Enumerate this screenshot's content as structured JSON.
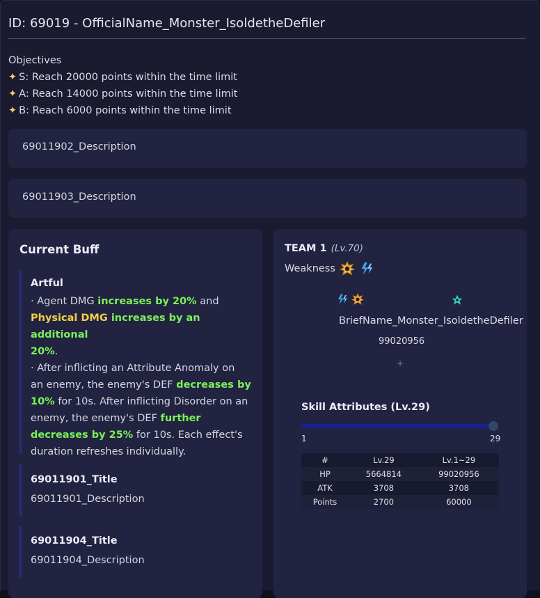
{
  "header": {
    "title": "ID: 69019 - OfficialName_Monster_IsoldetheDefiler"
  },
  "objectives": {
    "heading": "Objectives",
    "items": [
      "S: Reach 20000 points within the time limit",
      "A: Reach 14000 points within the time limit",
      "B: Reach 6000 points within the time limit"
    ]
  },
  "descriptions": [
    "69011902_Description",
    "69011903_Description"
  ],
  "buff": {
    "heading": "Current Buff",
    "artful": {
      "title": "Artful",
      "l1_a": "· Agent DMG ",
      "l1_b": "increases by 20%",
      "l1_c": " and",
      "l2_a": "Physical DMG",
      "l2_b": " increases by an additional",
      "l3_a": "20%",
      "l3_b": ".",
      "l4": "· After inflicting an Attribute Anomaly on",
      "l5_a": "an enemy, the enemy's DEF ",
      "l5_b": "decreases by",
      "l6_a": "10%",
      "l6_b": " for 10s. After inflicting Disorder on an",
      "l7_a": "enemy, the enemy's DEF ",
      "l7_b": "further",
      "l8_a": "decreases by 25%",
      "l8_b": " for 10s. Each effect's",
      "l9": "duration refreshes individually."
    },
    "items": [
      {
        "title": "69011901_Title",
        "desc": "69011901_Description"
      },
      {
        "title": "69011904_Title",
        "desc": "69011904_Description"
      }
    ]
  },
  "team": {
    "label": "TEAM 1",
    "level": "(Lv.70)",
    "weakness_label": "Weakness",
    "weakness_icons": [
      "physical-icon",
      "electric-icon"
    ],
    "monster": {
      "icons": [
        "electric-icon",
        "physical-icon",
        "ether-icon"
      ],
      "name": "BriefName_Monster_IsoldetheDefiler",
      "hp": "99020956",
      "expand": "+"
    }
  },
  "skill": {
    "heading": "Skill Attributes (Lv.29)",
    "slider": {
      "min": "1",
      "max": "29",
      "value": 29
    },
    "columns": [
      "#",
      "Lv.29",
      "Lv.1~29"
    ],
    "rows": [
      [
        "HP",
        "5664814",
        "99020956"
      ],
      [
        "ATK",
        "3708",
        "3708"
      ],
      [
        "Points",
        "2700",
        "60000"
      ]
    ]
  },
  "colors": {
    "highlight_green": "#7cf05a",
    "highlight_yellow": "#f2cf48",
    "star": "#f6cf5a",
    "slider_track": "#1a1f8f",
    "panel_bg": "#212340",
    "page_bg": "#1a1b30"
  }
}
